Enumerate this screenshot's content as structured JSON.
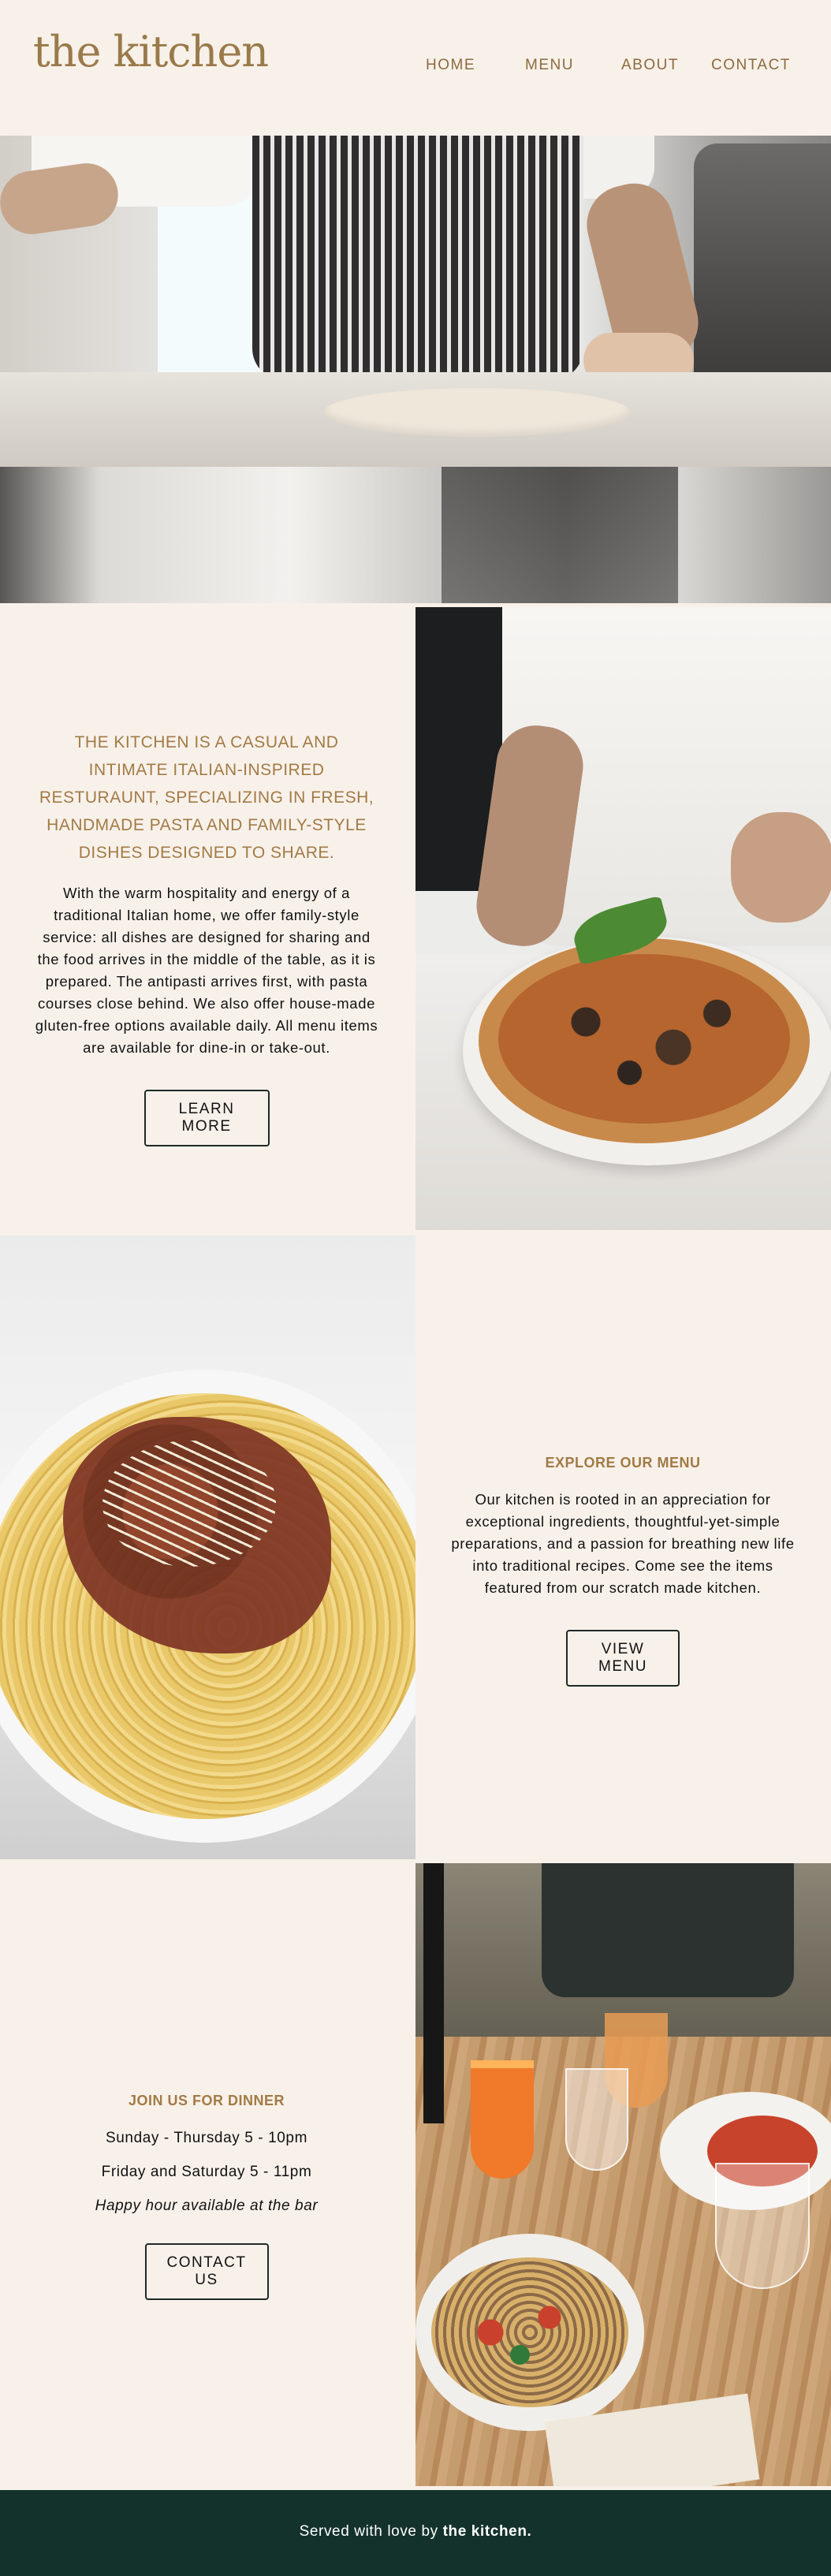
{
  "header": {
    "logo": "the kitchen",
    "nav": [
      {
        "label": "HOME"
      },
      {
        "label": "MENU"
      },
      {
        "label": "ABOUT"
      },
      {
        "label": "CONTACT"
      }
    ]
  },
  "about": {
    "tagline": "THE KITCHEN IS A CASUAL AND INTIMATE ITALIAN-INSPIRED RESTURAUNT, SPECIALIZING IN FRESH, HANDMADE PASTA AND FAMILY-STYLE DISHES DESIGNED TO SHARE.",
    "body": "With the warm hospitality and energy of a traditional Italian home, we offer family-style service: all dishes are designed for sharing and the food arrives in the middle of the table, as it is prepared. The antipasti arrives first, with pasta courses close behind. We also offer house-made gluten-free options available daily. All menu items are available for dine-in or take-out.",
    "button": "LEARN MORE"
  },
  "menu": {
    "title": "EXPLORE OUR MENU",
    "body": "Our kitchen is rooted in an appreciation for exceptional ingredients, thoughtful-yet-simple preparations, and a passion for breathing new life into traditional recipes. Come see the items featured from our scratch made kitchen.",
    "button": "VIEW MENU"
  },
  "dinner": {
    "title": "JOIN US FOR DINNER",
    "hours1": "Sunday - Thursday 5 - 10pm",
    "hours2": "Friday and Saturday 5 - 11pm",
    "happy_hour": "Happy hour available at the bar",
    "button": "CONTACT US"
  },
  "footer": {
    "prefix": "Served with love by ",
    "brand": "the kitchen."
  },
  "colors": {
    "background": "#f8f1ea",
    "accent": "#a27a45",
    "footer": "#13322b"
  }
}
